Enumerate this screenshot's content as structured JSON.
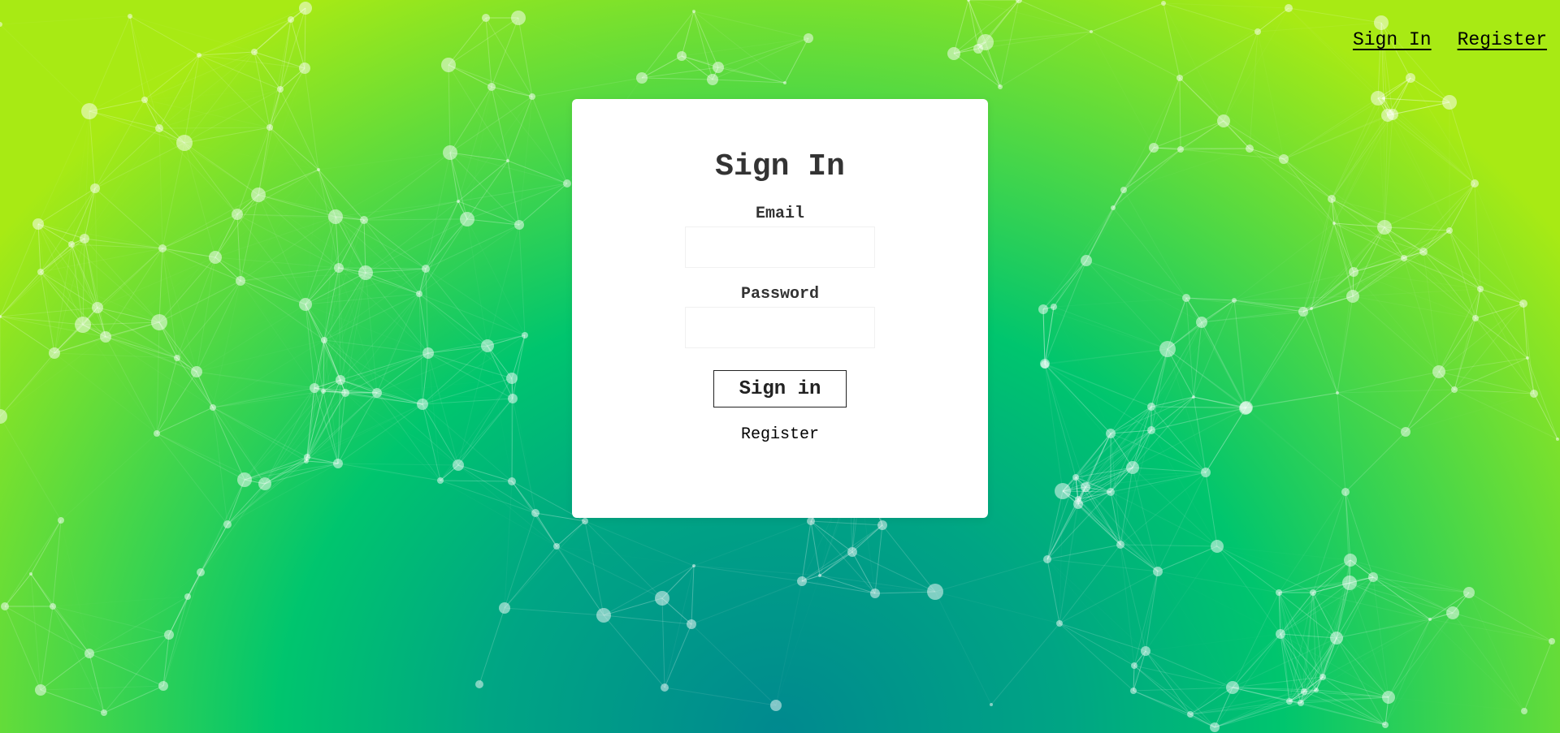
{
  "nav": {
    "signin_label": "Sign In",
    "register_label": "Register"
  },
  "login": {
    "title": "Sign In",
    "email_label": "Email",
    "email_value": "",
    "password_label": "Password",
    "password_value": "",
    "submit_label": "Sign in",
    "register_label": "Register"
  },
  "theme": {
    "card_background": "#ffffff",
    "particle_color": "#ffffff",
    "gradient_center": "#00898f",
    "gradient_edge": "#a8ea14"
  }
}
